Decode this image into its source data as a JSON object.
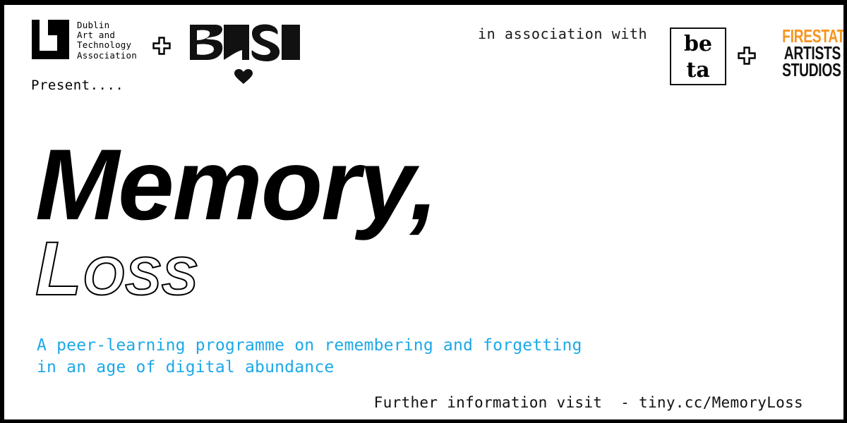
{
  "poster": {
    "background_color": "#ffffff",
    "border_color": "#000000"
  },
  "header": {
    "data_logo": {
      "icon_name": "data-square-mark",
      "lines": [
        "Dublin",
        "Art and",
        "Technology",
        "Association"
      ]
    },
    "plus_separator_1": "+",
    "base_logo": {
      "wordmark": "BASE",
      "heart": "♥"
    },
    "present_label": "Present....",
    "association_label": "in association with",
    "beta_logo": {
      "line1": "be",
      "line2": "ta"
    },
    "plus_separator_2": "+",
    "firestation_logo": {
      "line1": "FIRESTATION",
      "line2": "ARTISTS",
      "line3": "STUDIOS",
      "line1_color": "#F7941E",
      "line2_color": "#111111",
      "line3_color": "#111111"
    }
  },
  "main": {
    "title_line1": "Memory,",
    "title_line2": "Loss",
    "subtitle_line1": "A peer-learning programme on remembering and forgetting",
    "subtitle_line2": "in an age of digital abundance",
    "subtitle_color": "#1CA8E8"
  },
  "footer": {
    "info_text": "Further information visit  - tiny.cc/MemoryLoss"
  }
}
